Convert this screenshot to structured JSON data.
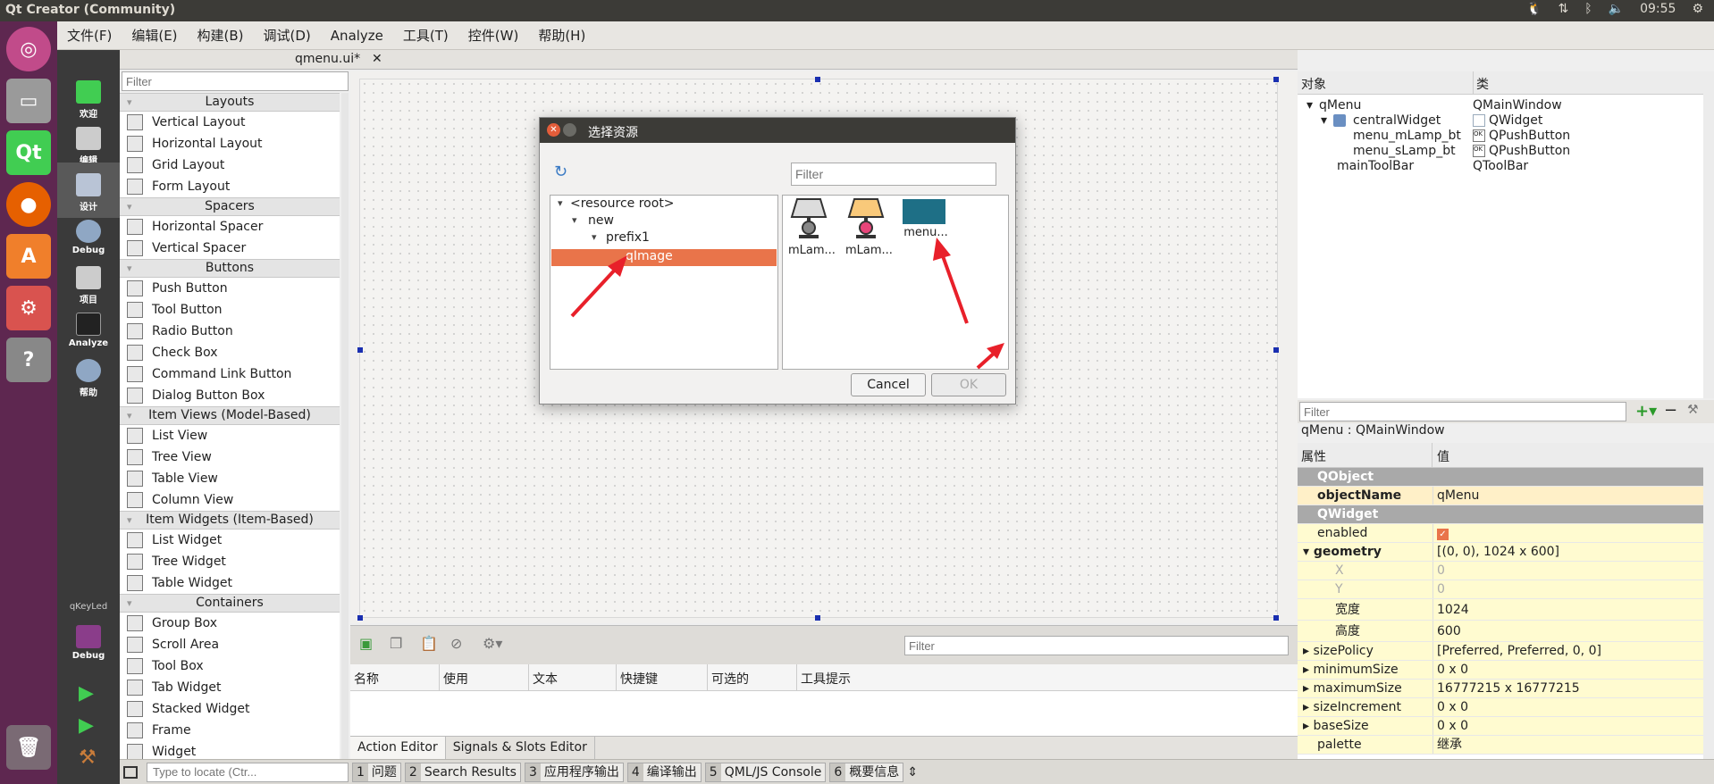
{
  "topbar": {
    "title": "Qt Creator (Community)",
    "clock": "09:55"
  },
  "menubar": [
    "文件(F)",
    "编辑(E)",
    "构建(B)",
    "调试(D)",
    "Analyze",
    "工具(T)",
    "控件(W)",
    "帮助(H)"
  ],
  "modes": {
    "welcome": "欢迎",
    "edit": "编辑",
    "design": "设计",
    "debug": "Debug",
    "projects": "项目",
    "analyze": "Analyze",
    "help": "帮助",
    "kit_project": "qKeyLed",
    "kit_config": "Debug"
  },
  "editor": {
    "file_tab": "qmenu.ui*"
  },
  "widgetbox": {
    "filter_placeholder": "Filter",
    "categories": [
      {
        "name": "Layouts",
        "items": [
          "Vertical Layout",
          "Horizontal Layout",
          "Grid Layout",
          "Form Layout"
        ]
      },
      {
        "name": "Spacers",
        "items": [
          "Horizontal Spacer",
          "Vertical Spacer"
        ]
      },
      {
        "name": "Buttons",
        "items": [
          "Push Button",
          "Tool Button",
          "Radio Button",
          "Check Box",
          "Command Link Button",
          "Dialog Button Box"
        ]
      },
      {
        "name": "Item Views (Model-Based)",
        "items": [
          "List View",
          "Tree View",
          "Table View",
          "Column View"
        ]
      },
      {
        "name": "Item Widgets (Item-Based)",
        "items": [
          "List Widget",
          "Tree Widget",
          "Table Widget"
        ]
      },
      {
        "name": "Containers",
        "items": [
          "Group Box",
          "Scroll Area",
          "Tool Box",
          "Tab Widget",
          "Stacked Widget",
          "Frame",
          "Widget"
        ]
      }
    ]
  },
  "action_editor": {
    "filter_placeholder": "Filter",
    "columns": [
      "名称",
      "使用",
      "文本",
      "快捷键",
      "可选的",
      "工具提示"
    ],
    "tabs": [
      "Action Editor",
      "Signals & Slots Editor"
    ]
  },
  "object_inspector": {
    "headers": [
      "对象",
      "类"
    ],
    "rows": [
      {
        "obj": "qMenu",
        "cls": "QMainWindow"
      },
      {
        "obj": "centralWidget",
        "cls": "QWidget"
      },
      {
        "obj": "menu_mLamp_bt",
        "cls": "QPushButton"
      },
      {
        "obj": "menu_sLamp_bt",
        "cls": "QPushButton"
      },
      {
        "obj": "mainToolBar",
        "cls": "QToolBar"
      }
    ]
  },
  "property_editor": {
    "filter_placeholder": "Filter",
    "class_label": "qMenu : QMainWindow",
    "headers": [
      "属性",
      "值"
    ],
    "rows": [
      {
        "name": "QObject",
        "value": ""
      },
      {
        "name": "objectName",
        "value": "qMenu"
      },
      {
        "name": "QWidget",
        "value": ""
      },
      {
        "name": "enabled",
        "value": ""
      },
      {
        "name": "geometry",
        "value": "[(0, 0), 1024 x 600]"
      },
      {
        "name": "X",
        "value": "0"
      },
      {
        "name": "Y",
        "value": "0"
      },
      {
        "name": "宽度",
        "value": "1024"
      },
      {
        "name": "高度",
        "value": "600"
      },
      {
        "name": "sizePolicy",
        "value": "[Preferred, Preferred, 0, 0]"
      },
      {
        "name": "minimumSize",
        "value": "0 x 0"
      },
      {
        "name": "maximumSize",
        "value": "16777215 x 16777215"
      },
      {
        "name": "sizeIncrement",
        "value": "0 x 0"
      },
      {
        "name": "baseSize",
        "value": "0 x 0"
      },
      {
        "name": "palette",
        "value": "继承"
      }
    ]
  },
  "statusbar": {
    "locate_placeholder": "Type to locate (Ctr...",
    "panes": [
      {
        "n": "1",
        "label": "问题"
      },
      {
        "n": "2",
        "label": "Search Results"
      },
      {
        "n": "3",
        "label": "应用程序输出"
      },
      {
        "n": "4",
        "label": "编译输出"
      },
      {
        "n": "5",
        "label": "QML/JS Console"
      },
      {
        "n": "6",
        "label": "概要信息"
      }
    ]
  },
  "dialog": {
    "title": "选择资源",
    "filter_placeholder": "Filter",
    "tree": [
      "<resource root>",
      "new",
      "prefix1",
      "qImage"
    ],
    "files": [
      "mLam...",
      "mLam...",
      "menu..."
    ],
    "cancel": "Cancel",
    "ok": "OK"
  },
  "colors": {
    "launcher": "#5e2750",
    "selection": "#e9744a",
    "arrow": "#e8202a",
    "handle": "#1a2fb0"
  }
}
